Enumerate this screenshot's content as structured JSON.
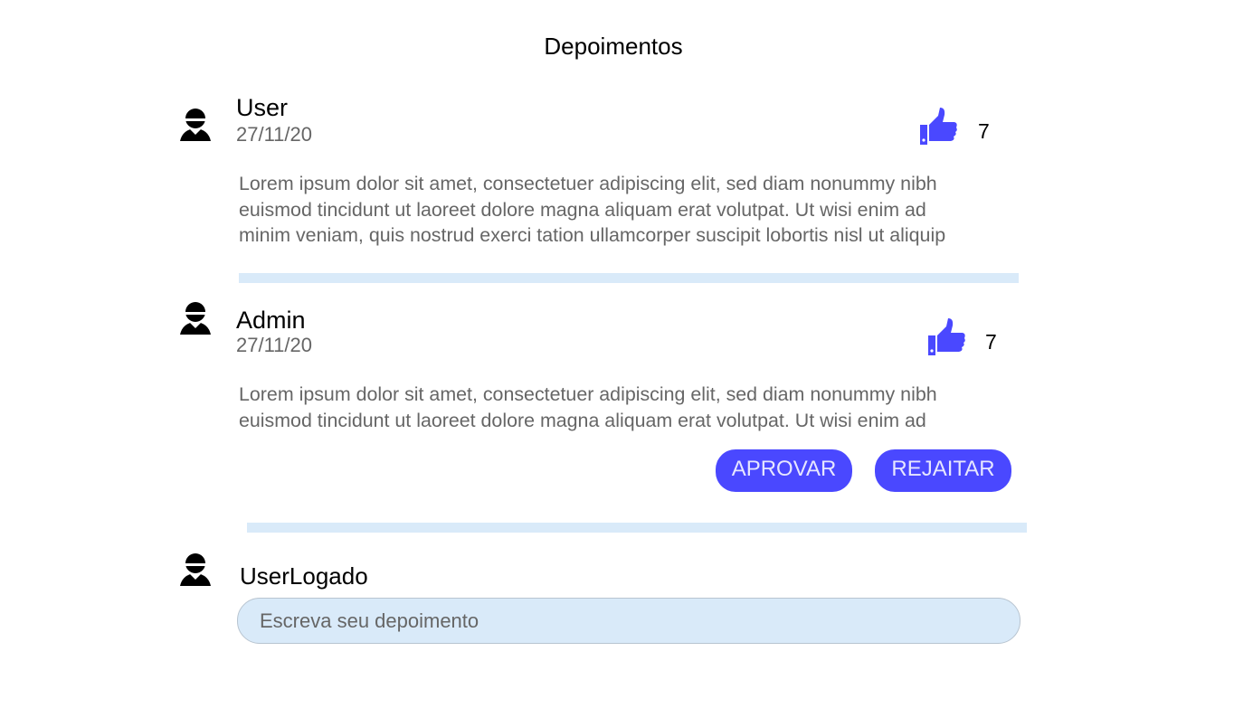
{
  "page": {
    "title": "Depoimentos"
  },
  "testimonials": [
    {
      "author": "User",
      "date": "27/11/20",
      "likes": "7",
      "text": "Lorem ipsum dolor sit amet, consectetuer adipiscing elit, sed diam nonummy nibh\neuismod tincidunt ut laoreet dolore magna aliquam erat volutpat. Ut wisi enim ad\nminim veniam, quis nostrud exerci tation ullamcorper suscipit lobortis nisl ut aliquip"
    },
    {
      "author": "Admin",
      "date": "27/11/20",
      "likes": "7",
      "text": "Lorem ipsum dolor sit amet, consectetuer adipiscing elit, sed diam nonummy nibh\neuismod tincidunt ut laoreet dolore magna aliquam erat volutpat. Ut wisi enim ad",
      "approve_label": "APROVAR",
      "reject_label": "REJAITAR"
    }
  ],
  "composer": {
    "user": "UserLogado",
    "placeholder": "Escreva seu depoimento",
    "value": ""
  },
  "icons": {
    "avatar": "user-avatar-icon",
    "like": "thumbs-up-icon"
  },
  "colors": {
    "accent": "#4a48ff",
    "divider": "#d9eaf9",
    "input_bg": "#d9eaf9",
    "muted_text": "#666666"
  }
}
